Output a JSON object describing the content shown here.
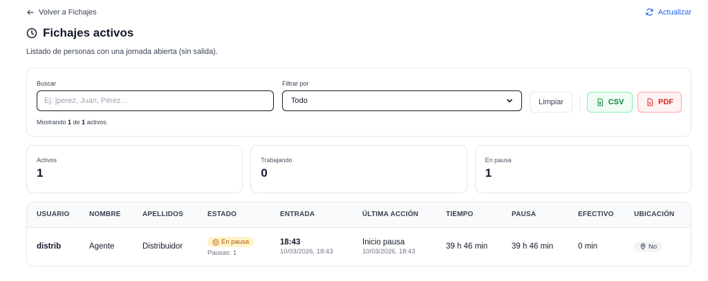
{
  "nav": {
    "back_label": "Volver a Fichajes",
    "refresh_label": "Actualizar"
  },
  "header": {
    "title": "Fichajes activos",
    "subtitle": "Listado de personas con una jornada abierta (sin salida)."
  },
  "filters": {
    "search_label": "Buscar",
    "search_placeholder": "Ej: jperez, Juan, Pérez…",
    "filter_label": "Filtrar por",
    "filter_value": "Todo",
    "clear_label": "Limpiar",
    "csv_label": "CSV",
    "pdf_label": "PDF",
    "showing_prefix": "Mostrando",
    "showing_count": "1",
    "showing_of": "de",
    "showing_total": "1",
    "showing_suffix": "activos."
  },
  "stats": [
    {
      "label": "Activos",
      "value": "1"
    },
    {
      "label": "Trabajando",
      "value": "0"
    },
    {
      "label": "En pausa",
      "value": "1"
    }
  ],
  "table": {
    "headers": [
      "USUARIO",
      "NOMBRE",
      "APELLIDOS",
      "ESTADO",
      "ENTRADA",
      "ÚLTIMA ACCIÓN",
      "TIEMPO",
      "PAUSA",
      "EFECTIVO",
      "UBICACIÓN"
    ],
    "rows": [
      {
        "usuario": "distrib",
        "nombre": "Agente",
        "apellidos": "Distribuidor",
        "estado": "En pausa",
        "pausas": "Pausas: 1",
        "entrada_time": "18:43",
        "entrada_date": "10/03/2026, 18:43",
        "ultima_accion": "Inicio pausa",
        "ultima_accion_date": "10/03/2026, 18:43",
        "tiempo": "39 h 46 min",
        "pausa": "39 h 46 min",
        "efectivo": "0 min",
        "ubicacion": "No"
      }
    ]
  },
  "colors": {
    "accent": "#2563eb",
    "csv": "#15803d",
    "pdf": "#dc2626",
    "pause": "#b45309"
  }
}
